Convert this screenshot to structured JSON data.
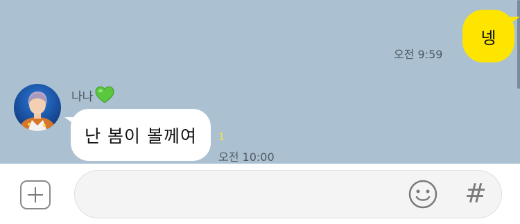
{
  "chat": {
    "messages": [
      {
        "sender": "me",
        "text": "넹",
        "time": "오전 9:59"
      },
      {
        "sender": "나나",
        "text": "난 봄이 볼께여",
        "time": "오전 10:00",
        "unread_count": "1"
      }
    ],
    "other_user": {
      "name": "나나",
      "name_emoji": "green-heart-icon"
    }
  },
  "input_bar": {
    "placeholder": "",
    "plus_icon": "plus-icon",
    "emoji_icon": "smiley-icon",
    "hash_icon": "hash-icon",
    "hash_label": "#"
  },
  "colors": {
    "chat_background": "#abc1d1",
    "my_bubble": "#fee500",
    "other_bubble": "#ffffff",
    "unread": "#f4e04a"
  }
}
